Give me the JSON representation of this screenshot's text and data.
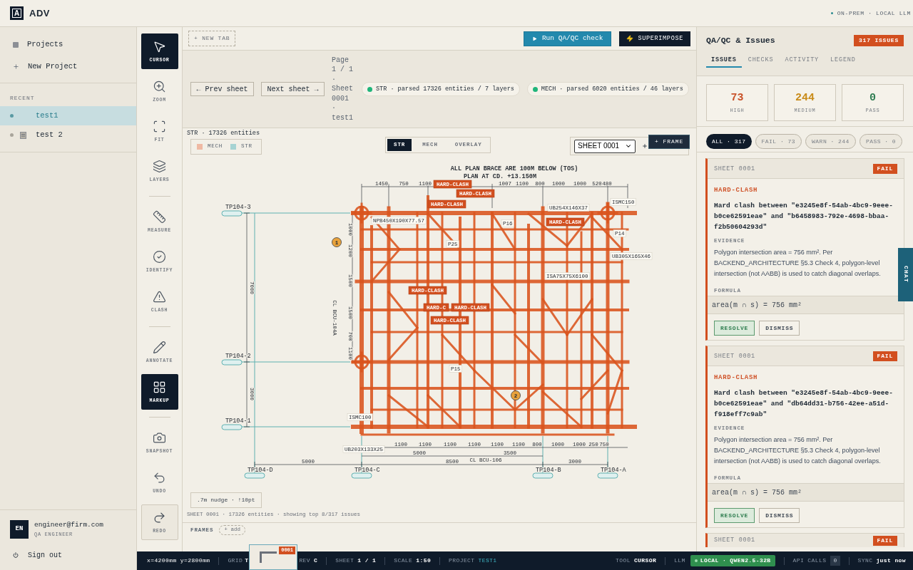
{
  "app": {
    "logo_letter": "A",
    "name": "ADV",
    "deployment": "ON-PREM · LOCAL LLM"
  },
  "sidebar": {
    "nav": [
      {
        "kind": "projects",
        "label": "Projects"
      },
      {
        "kind": "new",
        "label": "New Project"
      }
    ],
    "recent_heading": "RECENT",
    "recent": [
      {
        "name": "test1",
        "selected": true
      },
      {
        "name": "test 2",
        "selected": false
      }
    ],
    "user": {
      "initials": "EN",
      "email": "engineer@firm.com",
      "role": "QA ENGINEER"
    },
    "sign_out": "Sign out"
  },
  "tool_groups": [
    {
      "tools": [
        {
          "kind": "cursor",
          "label": "CURSOR",
          "selected": true,
          "focused": false
        },
        {
          "kind": "zoom",
          "label": "ZOOM",
          "selected": false,
          "focused": false
        },
        {
          "kind": "fit",
          "label": "FIT",
          "selected": false,
          "focused": false
        },
        {
          "kind": "layers",
          "label": "LAYERS",
          "selected": false,
          "focused": false
        }
      ]
    },
    {
      "tools": [
        {
          "kind": "measure",
          "label": "MEASURE",
          "selected": false,
          "focused": false
        },
        {
          "kind": "identify",
          "label": "IDENTIFY",
          "selected": false,
          "focused": false
        },
        {
          "kind": "clash",
          "label": "CLASH",
          "selected": false,
          "focused": false
        }
      ]
    },
    {
      "tools": [
        {
          "kind": "annotate",
          "label": "ANNOTATE",
          "selected": false,
          "focused": false
        },
        {
          "kind": "markup",
          "label": "MARKUP",
          "selected": true,
          "focused": false
        }
      ]
    },
    {
      "tools": [
        {
          "kind": "snapshot",
          "label": "SNAPSHOT",
          "selected": false,
          "focused": false
        },
        {
          "kind": "undo",
          "label": "UNDO",
          "selected": false,
          "focused": false
        },
        {
          "kind": "redo",
          "label": "REDO",
          "selected": false,
          "focused": true
        }
      ]
    }
  ],
  "tab_bar": {
    "new_tab": "+ NEW TAB",
    "run_check": "Run QA/QC check",
    "superimpose": "SUPERIMPOSE"
  },
  "sheet_nav": {
    "prev": "← Prev sheet",
    "next": "Next sheet →",
    "page_info": "Page 1 / 1 · Sheet 0001 · test1"
  },
  "parse_status": [
    {
      "text": "STR · parsed 17326 entities / 7 layers",
      "color": "#1fb57a"
    },
    {
      "text": "MECH · parsed 6020 entities / 46 layers",
      "color": "#1fb57a"
    }
  ],
  "canvas": {
    "entity_count": "STR · 17326 entities",
    "legend": [
      {
        "label": "MECH",
        "color": "#efb9a3"
      },
      {
        "label": "STR",
        "color": "#a6d3d3"
      }
    ],
    "view_modes": [
      {
        "label": "STR",
        "selected": true
      },
      {
        "label": "MECH",
        "selected": false
      },
      {
        "label": "OVERLAY",
        "selected": false
      }
    ],
    "sheet_select": "SHEET 0001",
    "frame_button": "+ FRAME",
    "drawing": {
      "notes": [
        "ALL PLAN BRACE ARE 100M BELOW (TOS)",
        "PLAN AT CD. +13.150M"
      ],
      "grid_rows": [
        "TP104-3",
        "TP104-2",
        "TP104-1"
      ],
      "grid_columns": [
        "TP104-D",
        "TP104-C",
        "TP104-B",
        "TP104-A"
      ],
      "top_dimensions": [
        "1450",
        "750",
        "1100",
        "1007",
        "1100",
        "800",
        "1000",
        "1000",
        "520",
        "480"
      ],
      "bottom_dimensions": [
        "1100",
        "1100",
        "1100",
        "1100",
        "1100",
        "1100",
        "800",
        "1000",
        "1000",
        "250",
        "750"
      ],
      "span_dimensions": [
        "5000",
        "3500"
      ],
      "overall_dimensions": [
        "5000",
        "8500",
        "3000"
      ],
      "row_dimensions": [
        "7000",
        "3000"
      ],
      "left_dimensions": [
        "1000",
        "1200",
        "1500",
        "1500",
        "700",
        "1100"
      ],
      "centerlines": [
        "CL BCU-104A",
        "CL BCU-106"
      ],
      "member_labels": [
        "NPB450X190X77.57",
        "UB254X146X37",
        "UB305X165X46",
        "ISA75X75X6100",
        "ISMC100",
        "UB203X133X25",
        "ISMC150",
        "P14",
        "P15",
        "P25",
        "P16"
      ],
      "clash_tags": [
        "HARD-CLASH",
        "HARD-CLASH",
        "HARD-CLASH",
        "HARD-CLASH",
        "HARD-CLASH",
        "HARD-C",
        "HARD-CLASH",
        "HARD-CLASH"
      ],
      "markers": [
        "1",
        "2"
      ]
    },
    "nudge_hint": ".7m nudge · ↑10pt",
    "footer": "SHEET 0001 · 17326 entities · showing top 8/317 issues"
  },
  "frames": {
    "label": "FRAMES",
    "add": "+ add",
    "thumbnail_badge": "0001"
  },
  "qa_panel": {
    "title": "QA/QC & Issues",
    "count_badge": "317 ISSUES",
    "tabs": [
      {
        "label": "ISSUES",
        "selected": true
      },
      {
        "label": "CHECKS",
        "selected": false
      },
      {
        "label": "ACTIVITY",
        "selected": false
      },
      {
        "label": "LEGEND",
        "selected": false
      }
    ],
    "stats": [
      {
        "value": "73",
        "label": "HIGH",
        "color": "#c9532a"
      },
      {
        "value": "244",
        "label": "MEDIUM",
        "color": "#c98c1a"
      },
      {
        "value": "0",
        "label": "PASS",
        "color": "#2f7d52"
      }
    ],
    "filters": [
      {
        "label": "ALL · 317",
        "selected": true
      },
      {
        "label": "FAIL · 73",
        "selected": false
      },
      {
        "label": "WARN · 244",
        "selected": false
      },
      {
        "label": "PASS · 0",
        "selected": false
      }
    ],
    "issues": [
      {
        "kind": "fail",
        "sheet": "SHEET 0001",
        "status": "FAIL",
        "type": "HARD-CLASH",
        "description": "Hard clash between \"e3245e8f-54ab-4bc9-9eee-b0ce62591eae\" and \"b6458983-792e-4698-bbaa-f2b50604293d\"",
        "evidence_label": "EVIDENCE",
        "evidence": "Polygon intersection area = 756 mm². Per BACKEND_ARCHITECTURE §5.3 Check 4, polygon-level intersection (not AABB) is used to catch diagonal overlaps.",
        "formula_label": "FORMULA",
        "formula": "area(m ∩ s) = 756 mm²",
        "actions": [
          {
            "kind": "resolve",
            "label": "RESOLVE"
          },
          {
            "kind": "dismiss",
            "label": "DISMISS"
          }
        ]
      },
      {
        "kind": "fail",
        "sheet": "SHEET 0001",
        "status": "FAIL",
        "type": "HARD-CLASH",
        "description": "Hard clash between \"e3245e8f-54ab-4bc9-9eee-b0ce62591eae\" and \"db64dd31-b756-42ee-a51d-f918eff7c9ab\"",
        "evidence_label": "EVIDENCE",
        "evidence": "Polygon intersection area = 756 mm². Per BACKEND_ARCHITECTURE §5.3 Check 4, polygon-level intersection (not AABB) is used to catch diagonal overlaps.",
        "formula_label": "FORMULA",
        "formula": "area(m ∩ s) = 756 mm²",
        "actions": [
          {
            "kind": "resolve",
            "label": "RESOLVE"
          },
          {
            "kind": "dismiss",
            "label": "DISMISS"
          }
        ]
      },
      {
        "kind": "fail",
        "sheet": "SHEET 0001",
        "status": "FAIL"
      }
    ]
  },
  "chat_tab": "CHAT",
  "status_bar": {
    "left": [
      {
        "kind": "plain",
        "label": "x=4200mm y=2800mm"
      },
      {
        "kind": "covered",
        "label": "GRID",
        "value": "T"
      },
      {
        "kind": "pair",
        "label": "REV",
        "value": "C"
      },
      {
        "kind": "pair",
        "label": "SHEET",
        "value": "1 / 1"
      },
      {
        "kind": "pair",
        "label": "SCALE",
        "value": "1:50"
      },
      {
        "kind": "accent",
        "label": "PROJECT",
        "value": "TEST1"
      }
    ],
    "right": [
      {
        "kind": "pair",
        "label": "TOOL",
        "value": "CURSOR"
      },
      {
        "kind": "pill",
        "label": "LLM",
        "value": "LOCAL · QWEN2.5-32B"
      },
      {
        "kind": "count",
        "label": "API CALLS",
        "value": "0"
      },
      {
        "kind": "pair",
        "label": "SYNC",
        "value": "just now"
      }
    ]
  }
}
